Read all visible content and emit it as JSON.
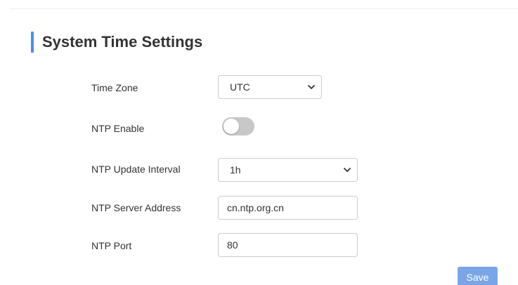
{
  "page": {
    "title": "System Time Settings",
    "accent_color": "#4a90e2"
  },
  "form": {
    "time_zone": {
      "label": "Time Zone",
      "value": "UTC",
      "icon": "chevron-down-icon"
    },
    "ntp_enable": {
      "label": "NTP Enable",
      "enabled": false
    },
    "ntp_update_interval": {
      "label": "NTP Update Interval",
      "value": "1h",
      "icon": "chevron-down-icon"
    },
    "ntp_server_address": {
      "label": "NTP Server Address",
      "value": "cn.ntp.org.cn"
    },
    "ntp_port": {
      "label": "NTP Port",
      "value": "80"
    }
  },
  "actions": {
    "save_label": "Save",
    "save_color": "#7aa6e8"
  }
}
